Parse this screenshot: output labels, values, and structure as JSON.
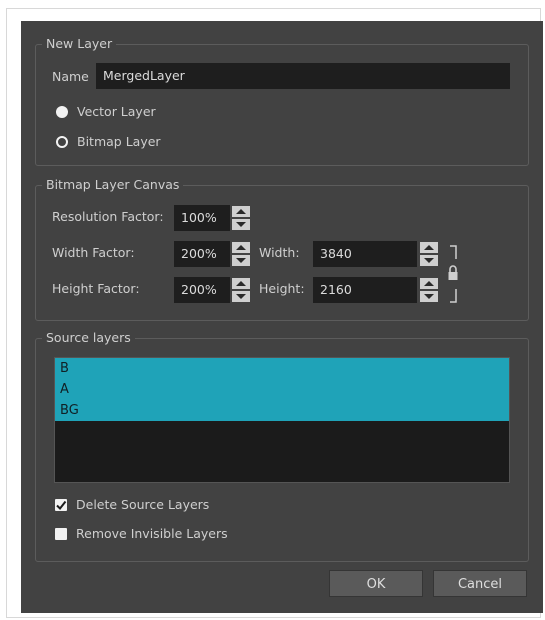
{
  "new_layer": {
    "legend": "New Layer",
    "name_label": "Name",
    "name_value": "MergedLayer",
    "options": [
      {
        "label": "Vector Layer",
        "selected": false
      },
      {
        "label": "Bitmap Layer",
        "selected": true
      }
    ]
  },
  "canvas": {
    "legend": "Bitmap Layer Canvas",
    "resolution_label": "Resolution Factor:",
    "resolution_value": "100%",
    "width_factor_label": "Width Factor:",
    "width_factor_value": "200%",
    "height_factor_label": "Height Factor:",
    "height_factor_value": "200%",
    "width_label": "Width:",
    "width_value": "3840",
    "height_label": "Height:",
    "height_value": "2160"
  },
  "source": {
    "legend": "Source layers",
    "layers": [
      "B",
      "A",
      "BG"
    ],
    "delete_label": "Delete Source Layers",
    "delete_checked": true,
    "remove_label": "Remove Invisible Layers",
    "remove_checked": false
  },
  "buttons": {
    "ok": "OK",
    "cancel": "Cancel"
  },
  "colors": {
    "dialog_bg": "#424242",
    "field_bg": "#1e1e1e",
    "selection": "#1fa3b8"
  }
}
